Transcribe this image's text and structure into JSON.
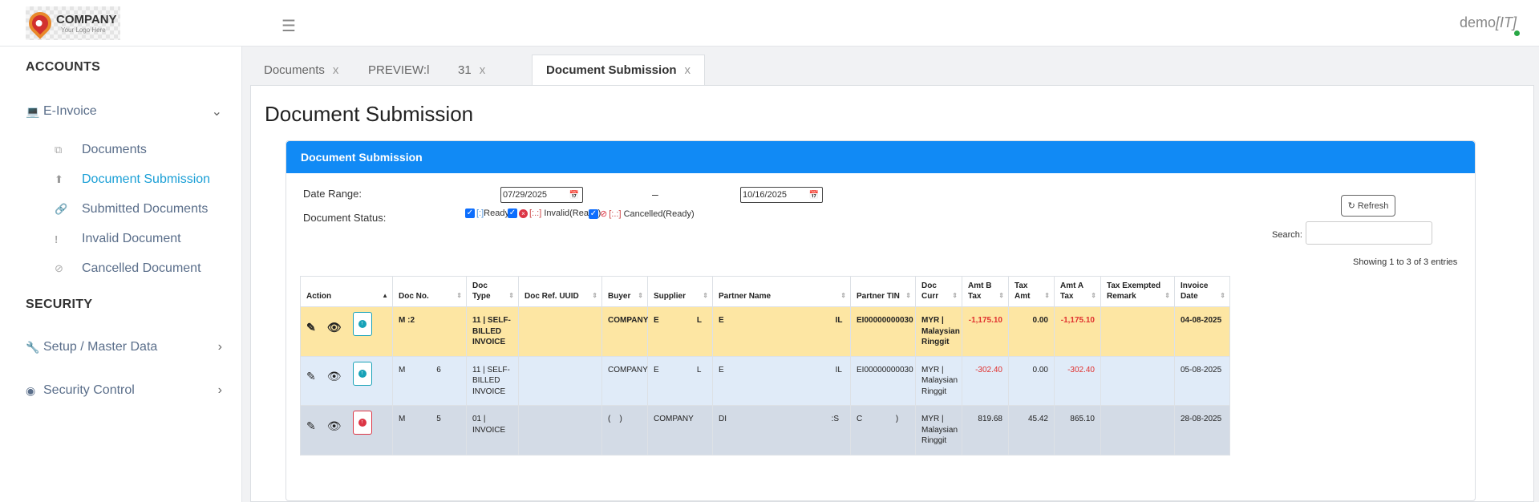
{
  "header": {
    "logo_name": "COMPANY",
    "logo_sub": "Your Logo Here",
    "user_name": "demo",
    "user_role": "[IT]"
  },
  "sidebar": {
    "accounts_title": "ACCOUNTS",
    "einvoice_label": "E-Invoice",
    "sub_items": [
      {
        "label": "Documents",
        "icon": "copy-icon"
      },
      {
        "label": "Document Submission",
        "icon": "upload-icon"
      },
      {
        "label": "Submitted Documents",
        "icon": "link-icon"
      },
      {
        "label": "Invalid Document",
        "icon": "exclamation-icon"
      },
      {
        "label": "Cancelled Document",
        "icon": "ban-icon"
      }
    ],
    "security_title": "SECURITY",
    "setup_label": "Setup / Master Data",
    "security_control_label": "Security Control"
  },
  "tabs": [
    {
      "label": "Documents"
    },
    {
      "label": "PREVIEW:l",
      "suffix": "31"
    },
    {
      "label": "Document Submission"
    }
  ],
  "tab_close": "x",
  "page": {
    "title": "Document Submission",
    "card_title": "Document Submission",
    "date_range_label": "Date Range:",
    "date_from": "07/29/2025",
    "date_sep": "–",
    "date_to": "10/16/2025",
    "refresh_label": "Refresh",
    "status_label": "Document Status:",
    "status_ready": "Ready",
    "status_invalid": "Invalid(Ready)",
    "status_cancelled": "Cancelled(Ready)",
    "search_label": "Search:",
    "entries_info": "Showing 1 to 3 of 3 entries"
  },
  "table": {
    "headers": [
      "Action",
      "Doc No.",
      "Doc Type",
      "Doc Ref. UUID",
      "Buyer",
      "Supplier",
      "Partner Name",
      "Partner TIN",
      "Doc Curr",
      "Amt B Tax",
      "Tax Amt",
      "Amt A Tax",
      "Tax Exempted Remark",
      "Invoice Date"
    ],
    "rows": [
      {
        "doc_no": "M             :2",
        "doc_type": "11 | SELF-BILLED INVOICE",
        "uuid": "",
        "buyer": "COMPANY",
        "supplier": "E                 L",
        "partner": "E                                                  IL",
        "tin": "EI00000000030",
        "curr": "MYR | Malaysian Ringgit",
        "amt_b": "-1,175.10",
        "tax": "0.00",
        "amt_a": "-1,175.10",
        "remark": "",
        "date": "04-08-2025"
      },
      {
        "doc_no": "M              6",
        "doc_type": "11 | SELF-BILLED INVOICE",
        "uuid": "",
        "buyer": "COMPANY",
        "supplier": "E                 L",
        "partner": "E                                                  IL",
        "tin": "EI00000000030",
        "curr": "MYR | Malaysian Ringgit",
        "amt_b": "-302.40",
        "tax": "0.00",
        "amt_a": "-302.40",
        "remark": "",
        "date": "05-08-2025"
      },
      {
        "doc_no": "M              5",
        "doc_type": "01 | INVOICE",
        "uuid": "",
        "buyer": "(    )",
        "supplier": "COMPANY",
        "partner": "DI                                               :S",
        "tin": "C               )",
        "curr": "MYR | Malaysian Ringgit",
        "amt_b": "819.68",
        "tax": "45.42",
        "amt_a": "865.10",
        "remark": "",
        "date": "28-08-2025"
      }
    ]
  }
}
